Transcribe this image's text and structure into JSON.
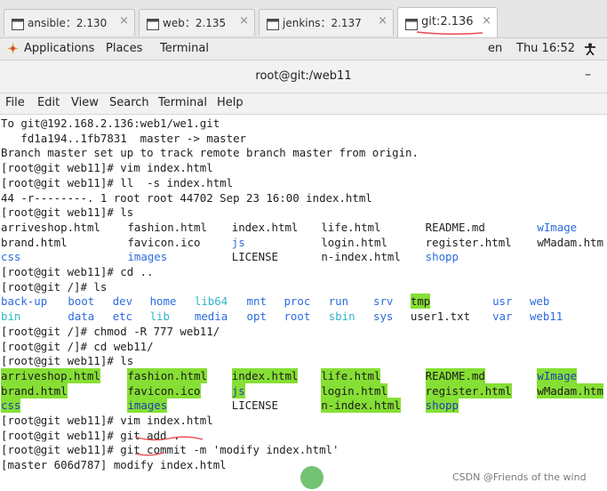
{
  "tabs": [
    {
      "label": "ansible：2.130",
      "icon": "terminal-icon",
      "active": false
    },
    {
      "label": "web：2.135",
      "icon": "terminal-icon",
      "active": false
    },
    {
      "label": "jenkins：2.137",
      "icon": "terminal-icon",
      "active": false
    },
    {
      "label": "git:2.136",
      "icon": "terminal-icon",
      "active": true
    }
  ],
  "tab_close_glyph": "×",
  "topbar": {
    "applications": "Applications",
    "places": "Places",
    "terminal": "Terminal",
    "lang": "en",
    "clock": "Thu 16:52"
  },
  "window": {
    "title": "root@git:/web11",
    "minimize": "–"
  },
  "menu": [
    "File",
    "Edit",
    "View",
    "Search",
    "Terminal",
    "Help"
  ],
  "terminal": {
    "lines": [
      [
        {
          "t": "To git@192.168.2.136:web1/we1.git"
        }
      ],
      [
        {
          "t": "   fd1a194..1fb7831  master -> master"
        }
      ],
      [
        {
          "t": "Branch master set up to track remote branch master from origin."
        }
      ],
      [
        {
          "t": "[root@git web11]# vim index.html"
        }
      ],
      [
        {
          "t": "[root@git web11]# ll  -s index.html"
        }
      ],
      [
        {
          "t": "44 -r--------. 1 root root 44702 Sep 23 16:00 index.html"
        }
      ],
      [
        {
          "t": "[root@git web11]# ls"
        }
      ],
      [
        {
          "t": "arriveshop.html",
          "c": 0
        },
        {
          "t": "fashion.html",
          "c": 17
        },
        {
          "t": "index.html",
          "c": 31
        },
        {
          "t": "life.html",
          "c": 43
        },
        {
          "t": "README.md",
          "c": 57
        },
        {
          "t": "wImage",
          "c": 72,
          "cls": "dir"
        }
      ],
      [
        {
          "t": "brand.html",
          "c": 0
        },
        {
          "t": "favicon.ico",
          "c": 17
        },
        {
          "t": "js",
          "c": 31,
          "cls": "dir"
        },
        {
          "t": "login.html",
          "c": 43
        },
        {
          "t": "register.html",
          "c": 57
        },
        {
          "t": "wMadam.htm",
          "c": 72
        }
      ],
      [
        {
          "t": "css",
          "c": 0,
          "cls": "dir"
        },
        {
          "t": "images",
          "c": 17,
          "cls": "dir"
        },
        {
          "t": "LICENSE",
          "c": 31
        },
        {
          "t": "n-index.html",
          "c": 43
        },
        {
          "t": "shopp",
          "c": 57,
          "cls": "dir"
        }
      ],
      [
        {
          "t": "[root@git web11]# cd .."
        }
      ],
      [
        {
          "t": "[root@git /]# ls"
        }
      ],
      [
        {
          "t": "back-up",
          "c": 0,
          "cls": "dir"
        },
        {
          "t": "boot",
          "c": 9,
          "cls": "dir"
        },
        {
          "t": "dev",
          "c": 15,
          "cls": "dir"
        },
        {
          "t": "home",
          "c": 20,
          "cls": "dir"
        },
        {
          "t": "lib64",
          "c": 26,
          "cls": "cy"
        },
        {
          "t": "mnt",
          "c": 33,
          "cls": "dir"
        },
        {
          "t": "proc",
          "c": 38,
          "cls": "dir"
        },
        {
          "t": "run",
          "c": 44,
          "cls": "dir"
        },
        {
          "t": "srv",
          "c": 50,
          "cls": "dir"
        },
        {
          "t": "tmp",
          "c": 55,
          "cls": "hl"
        },
        {
          "t": "usr",
          "c": 66,
          "cls": "dir"
        },
        {
          "t": "web",
          "c": 71,
          "cls": "dir"
        }
      ],
      [
        {
          "t": "bin",
          "c": 0,
          "cls": "cy"
        },
        {
          "t": "data",
          "c": 9,
          "cls": "dir"
        },
        {
          "t": "etc",
          "c": 15,
          "cls": "dir"
        },
        {
          "t": "lib",
          "c": 20,
          "cls": "cy"
        },
        {
          "t": "media",
          "c": 26,
          "cls": "dir"
        },
        {
          "t": "opt",
          "c": 33,
          "cls": "dir"
        },
        {
          "t": "root",
          "c": 38,
          "cls": "dir"
        },
        {
          "t": "sbin",
          "c": 44,
          "cls": "cy"
        },
        {
          "t": "sys",
          "c": 50,
          "cls": "dir"
        },
        {
          "t": "user1.txt",
          "c": 55
        },
        {
          "t": "var",
          "c": 66,
          "cls": "dir"
        },
        {
          "t": "web11",
          "c": 71,
          "cls": "dir"
        }
      ],
      [
        {
          "t": "[root@git /]# chmod -R 777 web11/"
        }
      ],
      [
        {
          "t": "[root@git /]# cd web11/"
        }
      ],
      [
        {
          "t": "[root@git web11]# ls"
        }
      ],
      [
        {
          "t": "arriveshop.html",
          "c": 0,
          "cls": "hl"
        },
        {
          "t": "fashion.html",
          "c": 17,
          "cls": "hl"
        },
        {
          "t": "index.html",
          "c": 31,
          "cls": "hl"
        },
        {
          "t": "life.html",
          "c": 43,
          "cls": "hl"
        },
        {
          "t": "README.md",
          "c": 57,
          "cls": "hl"
        },
        {
          "t": "wImage",
          "c": 72,
          "cls": "hl blue"
        }
      ],
      [
        {
          "t": "brand.html",
          "c": 0,
          "cls": "hl"
        },
        {
          "t": "favicon.ico",
          "c": 17,
          "cls": "hl"
        },
        {
          "t": "js",
          "c": 31,
          "cls": "hl blue"
        },
        {
          "t": "login.html",
          "c": 43,
          "cls": "hl"
        },
        {
          "t": "register.html",
          "c": 57,
          "cls": "hl"
        },
        {
          "t": "wMadam.htm",
          "c": 72,
          "cls": "hl"
        }
      ],
      [
        {
          "t": "css",
          "c": 0,
          "cls": "hl blue"
        },
        {
          "t": "images",
          "c": 17,
          "cls": "hl blue"
        },
        {
          "t": "LICENSE",
          "c": 31
        },
        {
          "t": "n-index.html",
          "c": 43,
          "cls": "hl"
        },
        {
          "t": "shopp",
          "c": 57,
          "cls": "hl blue"
        }
      ],
      [
        {
          "t": "[root@git web11]# vim index.html"
        }
      ],
      [
        {
          "t": "[root@git web11]# git add ."
        }
      ],
      [
        {
          "t": "[root@git web11]# git commit -m 'modify index.html'"
        }
      ],
      [
        {
          "t": "[master 606d787] modify index.html"
        }
      ]
    ]
  },
  "watermark": "CSDN @Friends of the wind",
  "colors": {
    "dir_blue": "#2d6cde",
    "link_cyan": "#31b5c6",
    "highlight_green": "#86df34",
    "annotation_red": "#e84a4a",
    "cursor_dot": "#5cb85c"
  }
}
